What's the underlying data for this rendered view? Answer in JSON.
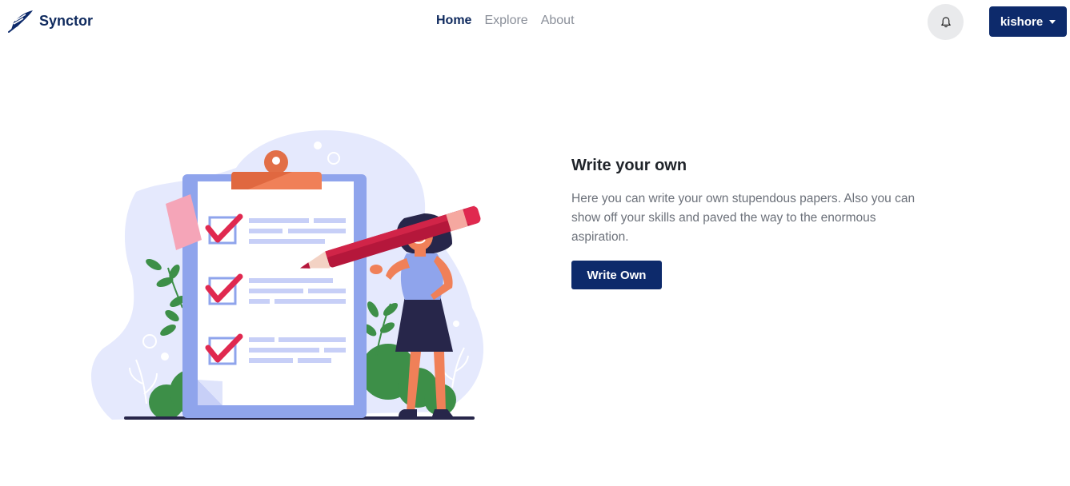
{
  "brand": {
    "name": "Synctor",
    "logo_icon": "quill-logo-icon"
  },
  "nav": {
    "links": [
      {
        "label": "Home",
        "active": true
      },
      {
        "label": "Explore",
        "active": false
      },
      {
        "label": "About",
        "active": false
      }
    ]
  },
  "header": {
    "notification_icon": "bell-icon",
    "user": {
      "name": "kishore",
      "caret_icon": "caret-down-icon"
    }
  },
  "hero": {
    "title": "Write your own",
    "description": "Here you can write your own stupendous papers. Also you can show off your skills and paved the way to the enormous aspiration.",
    "button_label": "Write Own"
  },
  "colors": {
    "primary": "#0d2a6b",
    "brand_text": "#0f2a5e",
    "muted_text": "#6c717a",
    "checkmark": "#e0294f",
    "clipboard": "#8fa4ec"
  }
}
